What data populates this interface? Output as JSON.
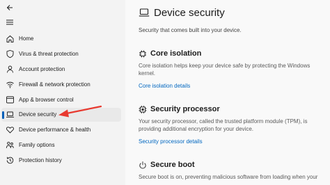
{
  "sidebar": {
    "items": [
      {
        "label": "Home",
        "icon": "home-icon"
      },
      {
        "label": "Virus & threat protection",
        "icon": "shield-icon"
      },
      {
        "label": "Account protection",
        "icon": "person-icon"
      },
      {
        "label": "Firewall & network protection",
        "icon": "wifi-icon"
      },
      {
        "label": "App & browser control",
        "icon": "app-browser-icon"
      },
      {
        "label": "Device security",
        "icon": "laptop-icon",
        "selected": true
      },
      {
        "label": "Device performance & health",
        "icon": "heart-icon"
      },
      {
        "label": "Family options",
        "icon": "family-icon"
      },
      {
        "label": "Protection history",
        "icon": "history-icon"
      }
    ]
  },
  "main": {
    "title": "Device security",
    "subtitle": "Security that comes built into your device.",
    "sections": [
      {
        "title": "Core isolation",
        "icon": "chip-icon",
        "description": "Core isolation helps keep your device safe by protecting the Windows kernel.",
        "link": "Core isolation details"
      },
      {
        "title": "Security processor",
        "icon": "processor-icon",
        "description": "Your security processor, called the trusted platform module (TPM), is providing additional encryption for your device.",
        "link": "Security processor details"
      },
      {
        "title": "Secure boot",
        "icon": "power-icon",
        "description": "Secure boot is on, preventing malicious software from loading when your"
      }
    ]
  },
  "colors": {
    "accent": "#005fb8",
    "link": "#0067c0",
    "annotation_arrow": "#e8392f",
    "sidebar_bg": "#f3f3f3",
    "content_bg": "#f9f9f9"
  }
}
